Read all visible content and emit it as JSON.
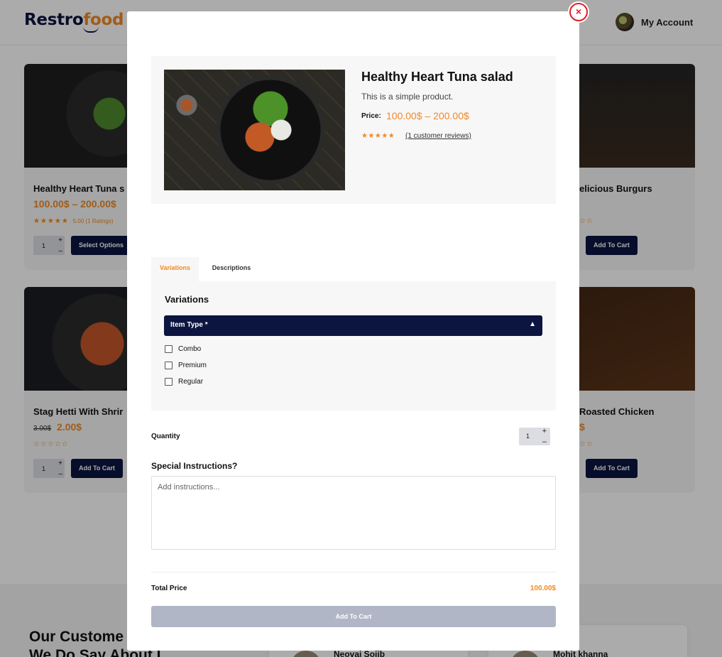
{
  "header": {
    "logo_part1": "Restro",
    "logo_part2": "food",
    "account_label": "My Account"
  },
  "background_cards": [
    {
      "title": "Healthy Heart Tuna s",
      "price": "100.00$ – 200.00$",
      "stars": "★★★★★",
      "rating_text": "5.00 (1 Ratings)",
      "qty": "1",
      "button": "Select Options"
    },
    {
      "title": "elicious Burgurs",
      "button": "Add To Cart",
      "stars": "☆☆"
    },
    {
      "title": "Stag Hetti With Shrir",
      "old_price": "3.00$",
      "price": "2.00$",
      "stars": "☆☆☆☆☆",
      "qty": "1",
      "button": "Add To Cart"
    },
    {
      "title": "Roasted Chicken",
      "button": "Add To Cart",
      "price": "$",
      "stars": "☆☆"
    }
  ],
  "testimonials": {
    "heading_line1": "Our Custome",
    "heading_line2": "We Do Say About I",
    "names": [
      "Neovai Sojib",
      "Mohit khanna"
    ]
  },
  "modal": {
    "close_icon": "×",
    "product": {
      "title": "Healthy Heart Tuna salad",
      "short_description": "This is a simple product.",
      "price_label": "Price:",
      "price": "100.00$ – 200.00$",
      "stars": "★★★★★",
      "reviews_link": "(1 customer reviews)"
    },
    "tabs": [
      {
        "label": "Variations",
        "active": true
      },
      {
        "label": "Descriptions",
        "active": false
      }
    ],
    "variations": {
      "heading": "Variations",
      "group_label": "Item Type *",
      "chevron": "▲",
      "options": [
        "Combo",
        "Premium",
        "Regular"
      ]
    },
    "quantity": {
      "label": "Quantity",
      "value": "1",
      "plus": "+",
      "minus": "–"
    },
    "special_instructions": {
      "label": "Special Instructions?",
      "placeholder": "Add instructions..."
    },
    "total": {
      "label": "Total Price",
      "value": "100.00$"
    },
    "add_to_cart_label": "Add To Cart"
  },
  "colors": {
    "accent": "#f08a24",
    "navy": "#0b1540",
    "close_red": "#e11d2b",
    "disabled_button": "#b0b6c6"
  }
}
